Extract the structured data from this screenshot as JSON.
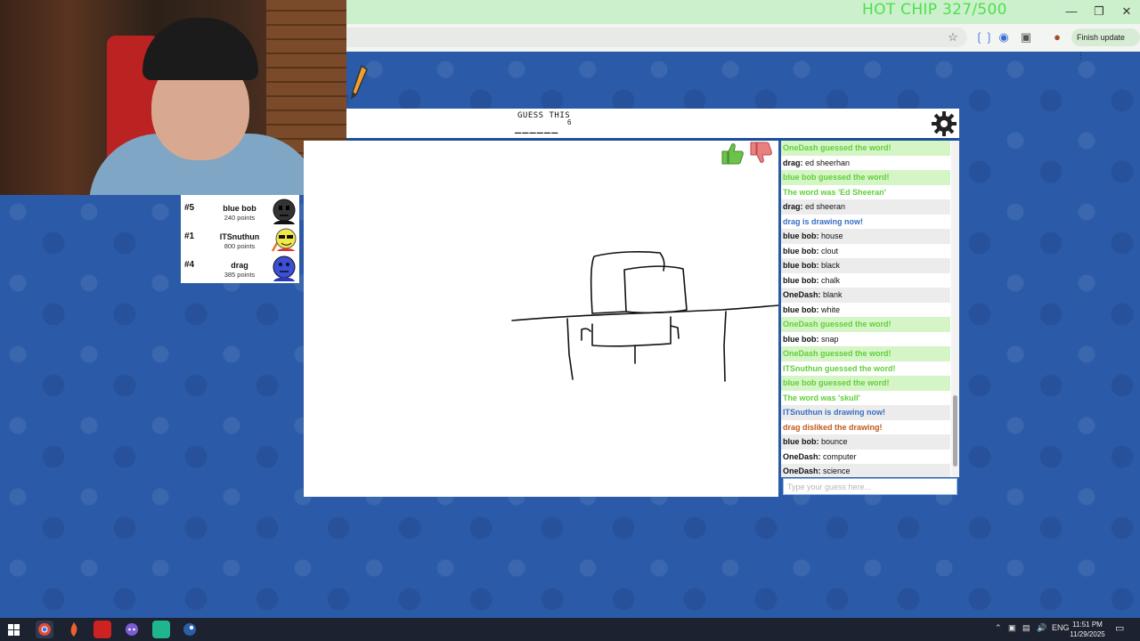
{
  "stream": {
    "overlay_text": "HOT CHIP 327/500"
  },
  "browser": {
    "finish_update_label": "Finish update"
  },
  "game": {
    "guess_label": "GUESS THIS",
    "word_length": "6",
    "word_blanks": "______"
  },
  "players": [
    {
      "rank": "#5",
      "name": "blue bob",
      "points": "240 points"
    },
    {
      "rank": "#1",
      "name": "ITSnuthun",
      "points": "800 points"
    },
    {
      "rank": "#4",
      "name": "drag",
      "points": "385 points"
    }
  ],
  "chat": {
    "messages": [
      {
        "user": "",
        "text": "OneDash guessed the word!"
      },
      {
        "user": "drag:",
        "text": " ed sheerhan"
      },
      {
        "user": "",
        "text": "blue bob guessed the word!"
      },
      {
        "user": "",
        "text": "The word was 'Ed Sheeran'"
      },
      {
        "user": "drag:",
        "text": " ed sheeran"
      },
      {
        "user": "",
        "text": "drag is drawing now!"
      },
      {
        "user": "blue bob:",
        "text": " house"
      },
      {
        "user": "blue bob:",
        "text": " clout"
      },
      {
        "user": "blue bob:",
        "text": " black"
      },
      {
        "user": "blue bob:",
        "text": " chalk"
      },
      {
        "user": "OneDash:",
        "text": " blank"
      },
      {
        "user": "blue bob:",
        "text": " white"
      },
      {
        "user": "",
        "text": "OneDash guessed the word!"
      },
      {
        "user": "blue bob:",
        "text": " snap"
      },
      {
        "user": "",
        "text": "OneDash guessed the word!"
      },
      {
        "user": "",
        "text": "ITSnuthun guessed the word!"
      },
      {
        "user": "",
        "text": "blue bob guessed the word!"
      },
      {
        "user": "",
        "text": "The word was 'skull'"
      },
      {
        "user": "",
        "text": "ITSnuthun is drawing now!"
      },
      {
        "user": "",
        "text": "drag disliked the drawing!"
      },
      {
        "user": "blue bob:",
        "text": " bounce"
      },
      {
        "user": "OneDash:",
        "text": " computer"
      },
      {
        "user": "OneDash:",
        "text": " science"
      }
    ],
    "input_placeholder": "Type your guess here..."
  },
  "taskbar": {
    "lang": "ENG",
    "time": "11:51 PM",
    "date": "11/29/2025"
  },
  "colors": {
    "guessed_green": "#5fcf3a",
    "drawing_blue": "#3a6fc0",
    "dislike_orange": "#c25a1e",
    "page_blue": "#2b5ba8"
  }
}
